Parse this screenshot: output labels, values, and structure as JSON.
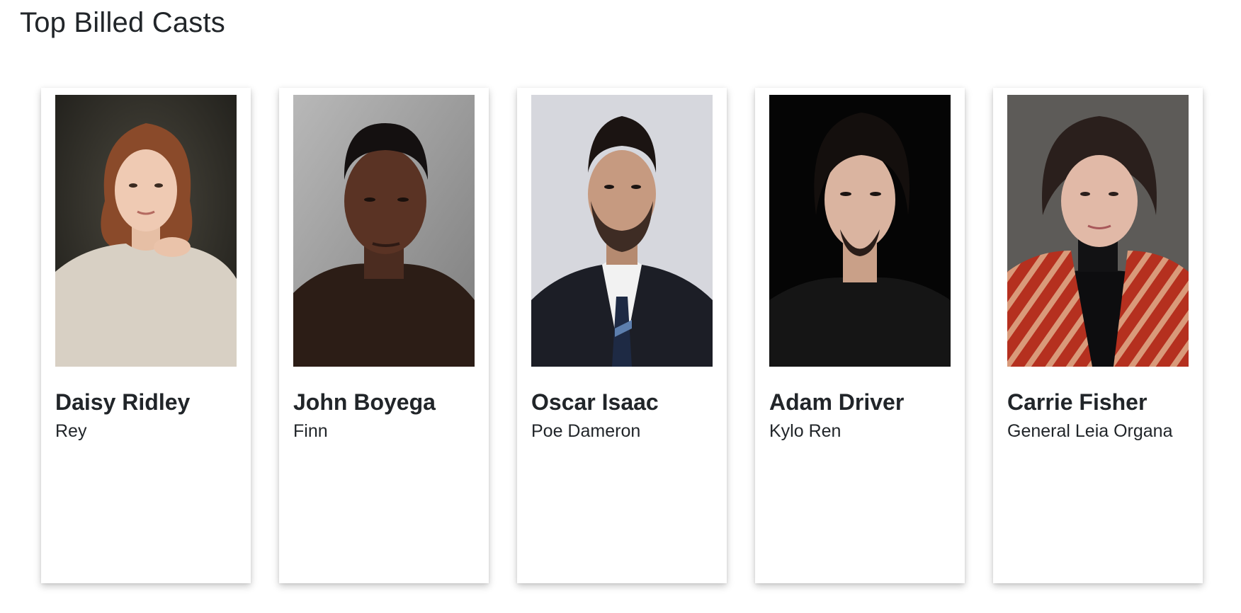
{
  "section": {
    "title": "Top Billed Casts"
  },
  "cast": [
    {
      "name": "Daisy Ridley",
      "character": "Rey"
    },
    {
      "name": "John Boyega",
      "character": "Finn"
    },
    {
      "name": "Oscar Isaac",
      "character": "Poe Dameron"
    },
    {
      "name": "Adam Driver",
      "character": "Kylo Ren"
    },
    {
      "name": "Carrie Fisher",
      "character": "General Leia Organa"
    }
  ],
  "colors": {
    "text": "#212529",
    "card_background": "#ffffff"
  }
}
